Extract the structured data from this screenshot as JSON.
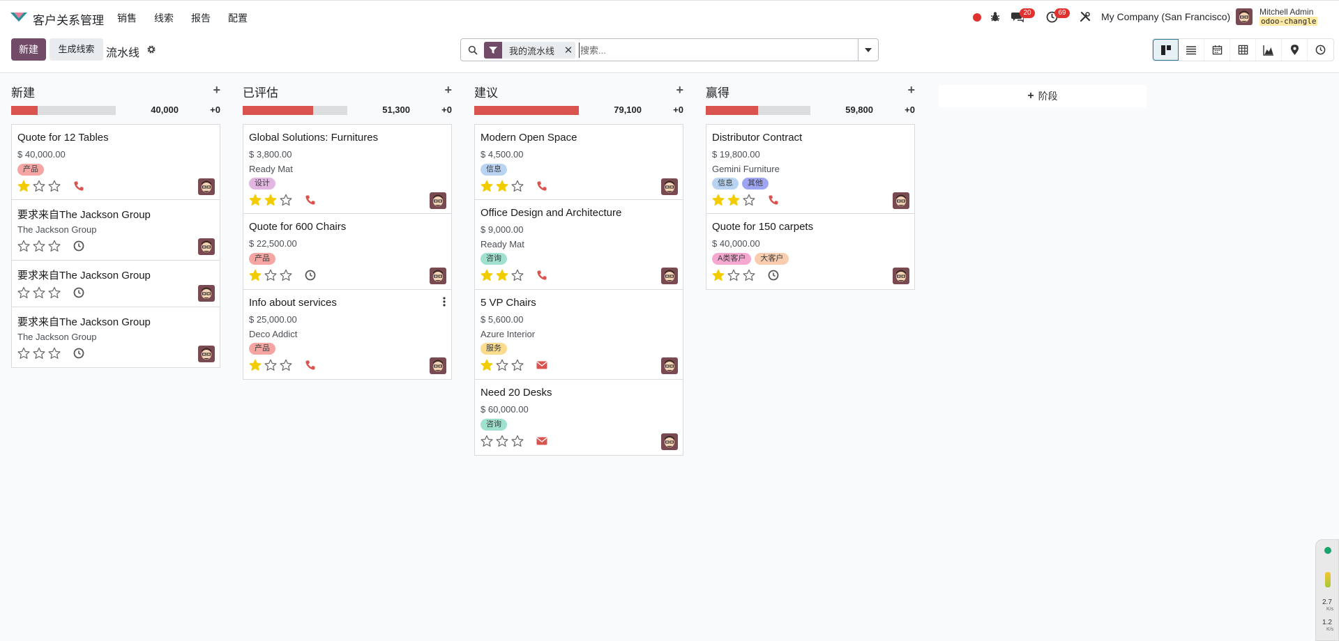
{
  "navbar": {
    "app_title": "客户关系管理",
    "menu": [
      "销售",
      "线索",
      "报告",
      "配置"
    ],
    "chat_badge": "20",
    "activity_badge": "69",
    "company": "My Company (San Francisco)",
    "user_name": "Mitchell Admin",
    "db_name": "odoo-changle"
  },
  "control_panel": {
    "new_label": "新建",
    "generate_label": "生成线索",
    "breadcrumb": "流水线",
    "facet_label": "我的流水线",
    "search_placeholder": "搜索..."
  },
  "add_stage_label": "阶段",
  "side_widget": {
    "up": "2.7",
    "up_unit": "K/s",
    "down": "1.2",
    "down_unit": "K/s"
  },
  "columns": [
    {
      "title": "新建",
      "total": "40,000",
      "plus": "+0",
      "progress": 0.25,
      "cards": [
        {
          "title": "Quote for 12 Tables",
          "amount": "$ 40,000.00",
          "tags": [
            {
              "text": "产品",
              "color": "#f6a6a2"
            }
          ],
          "stars": 1,
          "activity": "phone"
        },
        {
          "title": "要求来自The Jackson Group",
          "company": "The Jackson Group",
          "stars": 0,
          "activity": "clock"
        },
        {
          "title": "要求来自The Jackson Group",
          "stars": 0,
          "activity": "clock"
        },
        {
          "title": "要求来自The Jackson Group",
          "company": "The Jackson Group",
          "stars": 0,
          "activity": "clock"
        }
      ]
    },
    {
      "title": "已评估",
      "total": "51,300",
      "plus": "+0",
      "progress": 0.67,
      "cards": [
        {
          "title": "Global Solutions: Furnitures",
          "amount": "$ 3,800.00",
          "company": "Ready Mat",
          "tags": [
            {
              "text": "设计",
              "color": "#e1b6e0"
            }
          ],
          "stars": 2,
          "activity": "phone"
        },
        {
          "title": "Quote for 600 Chairs",
          "amount": "$ 22,500.00",
          "tags": [
            {
              "text": "产品",
              "color": "#f6a6a2"
            }
          ],
          "stars": 1,
          "activity": "clock"
        },
        {
          "title": "Info about services",
          "amount": "$ 25,000.00",
          "company": "Deco Addict",
          "tags": [
            {
              "text": "产品",
              "color": "#f6a6a2"
            }
          ],
          "stars": 1,
          "activity": "phone",
          "kebab": true
        }
      ]
    },
    {
      "title": "建议",
      "total": "79,100",
      "plus": "+0",
      "progress": 1.0,
      "cards": [
        {
          "title": "Modern Open Space",
          "amount": "$ 4,500.00",
          "tags": [
            {
              "text": "信息",
              "color": "#b9d4f3"
            }
          ],
          "stars": 2,
          "activity": "phone"
        },
        {
          "title": "Office Design and Architecture",
          "amount": "$ 9,000.00",
          "company": "Ready Mat",
          "tags": [
            {
              "text": "咨询",
              "color": "#9fe0cf"
            }
          ],
          "stars": 2,
          "activity": "phone"
        },
        {
          "title": "5 VP Chairs",
          "amount": "$ 5,600.00",
          "company": "Azure Interior",
          "tags": [
            {
              "text": "服务",
              "color": "#fbdc8e"
            }
          ],
          "stars": 1,
          "activity": "mail"
        },
        {
          "title": "Need 20 Desks",
          "amount": "$ 60,000.00",
          "tags": [
            {
              "text": "咨询",
              "color": "#9fe0cf"
            }
          ],
          "stars": 0,
          "activity": "mail"
        }
      ]
    },
    {
      "title": "赢得",
      "total": "59,800",
      "plus": "+0",
      "progress": 0.5,
      "cards": [
        {
          "title": "Distributor Contract",
          "amount": "$ 19,800.00",
          "company": "Gemini Furniture",
          "tags": [
            {
              "text": "信息",
              "color": "#b9d4f3"
            },
            {
              "text": "其他",
              "color": "#9ea6f2"
            }
          ],
          "stars": 2,
          "activity": "phone"
        },
        {
          "title": "Quote for 150 carpets",
          "amount": "$ 40,000.00",
          "tags": [
            {
              "text": "A类客户",
              "color": "#f5a9d0"
            },
            {
              "text": "大客户",
              "color": "#f8cdb0"
            }
          ],
          "stars": 1,
          "activity": "clock"
        }
      ]
    }
  ]
}
